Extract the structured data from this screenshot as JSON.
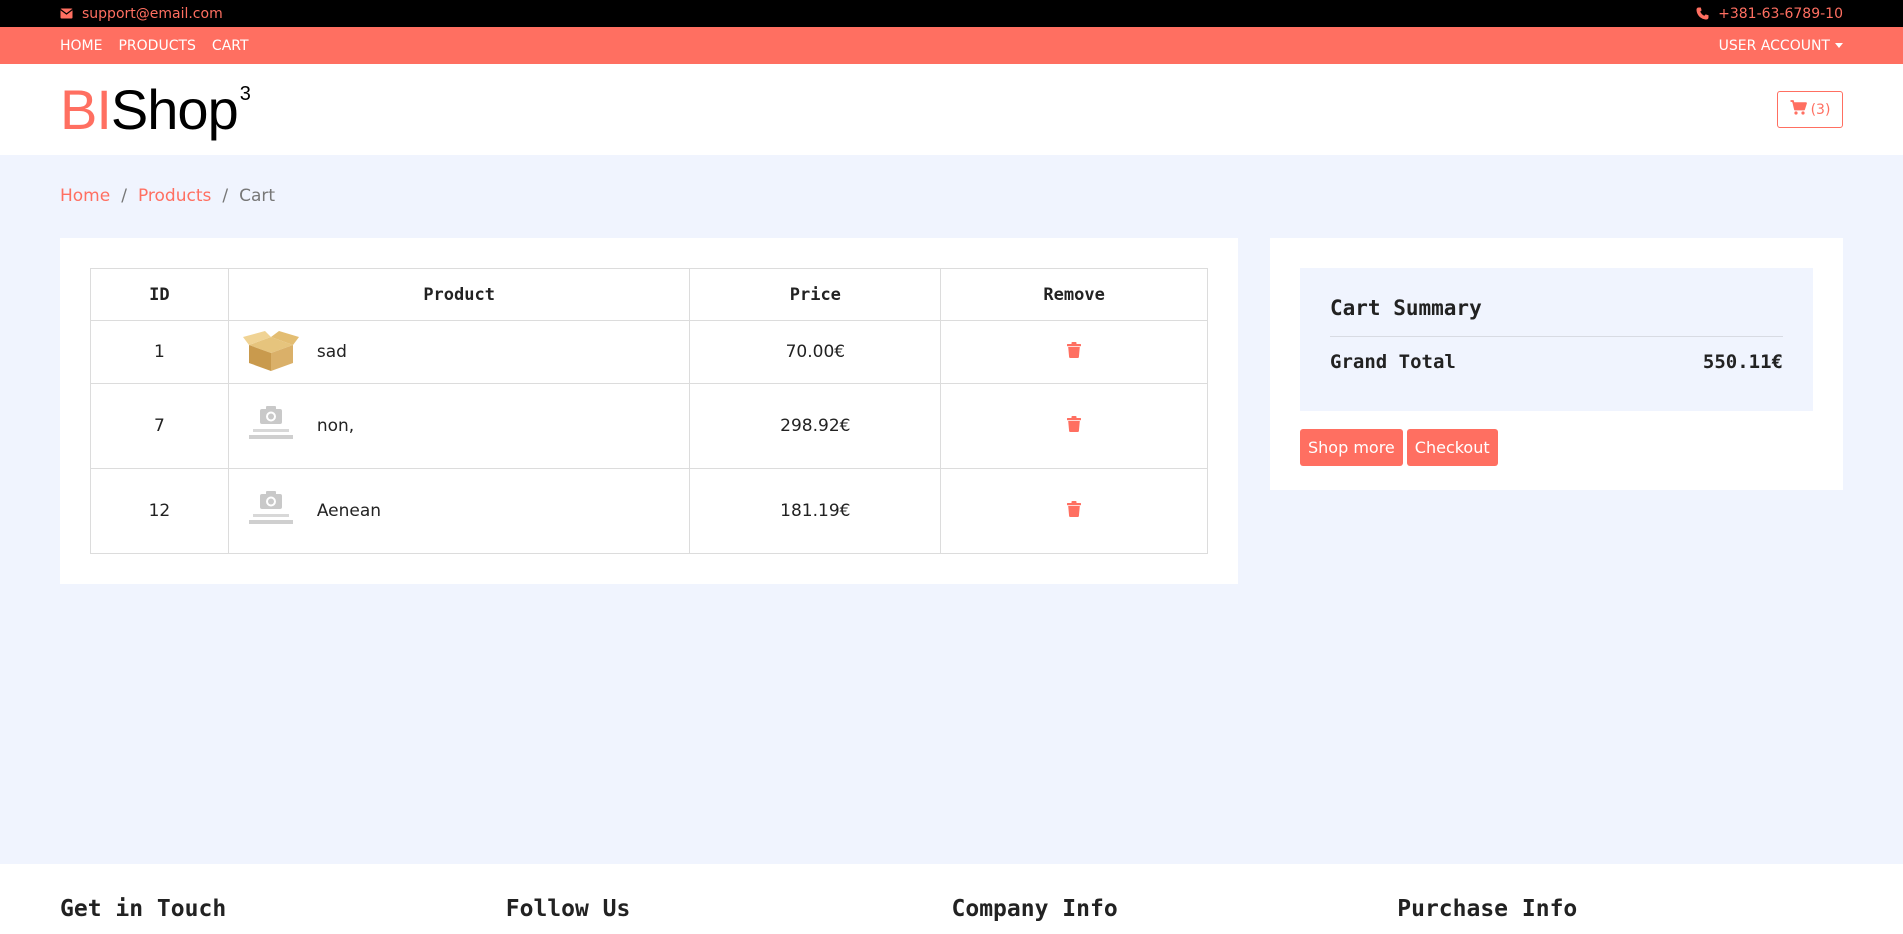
{
  "topbar": {
    "email": "support@email.com",
    "phone": "+381-63-6789-10"
  },
  "nav": {
    "links": [
      "HOME",
      "PRODUCTS",
      "CART"
    ],
    "account": "USER ACCOUNT"
  },
  "header": {
    "logo_bi": "BI",
    "logo_shop": "Shop",
    "logo_sup": "3",
    "cart_count": "(3)"
  },
  "breadcrumb": [
    "Home",
    "Products",
    "Cart"
  ],
  "cart_table": {
    "headers": [
      "ID",
      "Product",
      "Price",
      "Remove"
    ],
    "rows": [
      {
        "id": "1",
        "name": "sad",
        "price": "70.00€",
        "image": "cardboard-box"
      },
      {
        "id": "7",
        "name": "non,",
        "price": "298.92€",
        "image": "coming-soon"
      },
      {
        "id": "12",
        "name": "Aenean",
        "price": "181.19€",
        "image": "coming-soon"
      }
    ]
  },
  "summary": {
    "title": "Cart Summary",
    "grand_total_label": "Grand Total",
    "grand_total_value": "550.11€",
    "shop_more": "Shop more",
    "checkout": "Checkout"
  },
  "footer": {
    "headings": [
      "Get in Touch",
      "Follow Us",
      "Company Info",
      "Purchase Info"
    ]
  },
  "colors": {
    "accent": "#ff6f61",
    "background": "#f0f4fe",
    "topbar": "#000000"
  },
  "icons": [
    "envelope-icon",
    "phone-icon",
    "cart-icon",
    "trash-icon",
    "caret-down-icon"
  ]
}
